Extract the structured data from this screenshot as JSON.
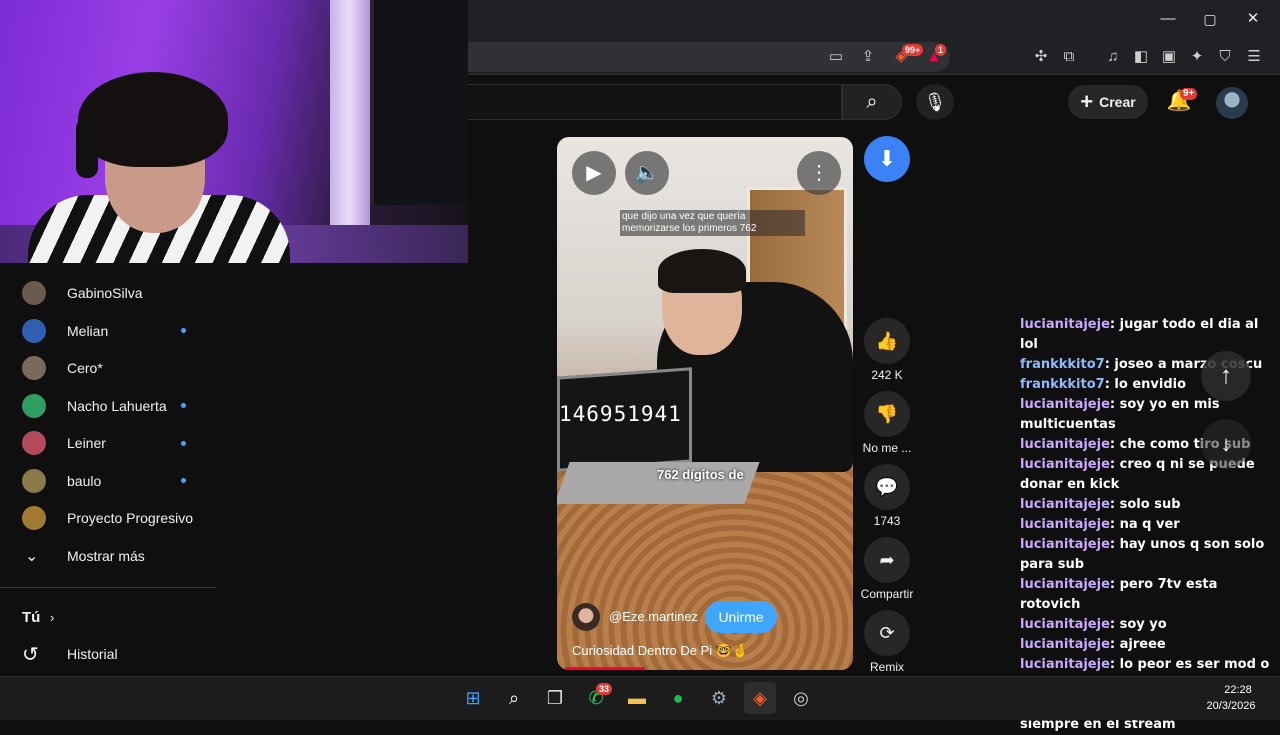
{
  "browser": {
    "minimize_glyph": "—",
    "maximize_glyph": "▢",
    "close_glyph": "✕",
    "brave_badge": "99+",
    "rewards_badge": "1"
  },
  "header": {
    "create_label": "Crear",
    "notifications_badge": "9+"
  },
  "sidebar": {
    "subscriptions": [
      {
        "name": "GabinoSilva",
        "live": false,
        "color": "#6b5a4e"
      },
      {
        "name": "Melian",
        "live": true,
        "color": "#2f5fb3"
      },
      {
        "name": "Cero*",
        "live": false,
        "color": "#7a6a5a"
      },
      {
        "name": "Nacho Lahuerta",
        "live": true,
        "color": "#2e9d62"
      },
      {
        "name": "Leiner",
        "live": true,
        "color": "#b34a5a"
      },
      {
        "name": "baulo",
        "live": true,
        "color": "#8a7a4a"
      },
      {
        "name": "Proyecto Progresivo",
        "live": false,
        "color": "#a07a30"
      }
    ],
    "show_more_label": "Mostrar más",
    "you_label": "Tú",
    "history_label": "Historial"
  },
  "short": {
    "caption_top": "que dijo una vez que quería memorizarse los primeros 762",
    "screen_digits": "146951941",
    "caption_mid": "762 dígitos de",
    "channel": "@Eze.martinez",
    "join_label": "Unirme",
    "title": "Curiosidad Dentro De Pi 🤓🤞"
  },
  "actions": {
    "likes": "242 K",
    "dislike_label": "No me ...",
    "comments": "1743",
    "share_label": "Compartir",
    "remix_label": "Remix"
  },
  "chat": [
    {
      "user": "lucianitajeje",
      "text": "jugar todo el dia al lol",
      "color": "u1"
    },
    {
      "user": "frankkkito7",
      "text": "joseo a marzo coscu",
      "color": "u2"
    },
    {
      "user": "frankkkito7",
      "text": "lo envidio",
      "color": "u2"
    },
    {
      "user": "lucianitajeje",
      "text": "soy yo en mis multicuentas",
      "color": "u1"
    },
    {
      "user": "lucianitajeje",
      "text": "che como tiro sub",
      "color": "u1"
    },
    {
      "user": "lucianitajeje",
      "text": "creo q ni se puede donar en kick",
      "color": "u1"
    },
    {
      "user": "lucianitajeje",
      "text": "solo sub",
      "color": "u1"
    },
    {
      "user": "lucianitajeje",
      "text": "na q ver",
      "color": "u1"
    },
    {
      "user": "lucianitajeje",
      "text": "hay unos q son solo para sub",
      "color": "u1"
    },
    {
      "user": "lucianitajeje",
      "text": "pero 7tv esta rotovich",
      "color": "u1"
    },
    {
      "user": "lucianitajeje",
      "text": "soy yo",
      "color": "u1"
    },
    {
      "user": "lucianitajeje",
      "text": "ajreee",
      "color": "u1"
    },
    {
      "user": "lucianitajeje",
      "text": "lo peor es ser mod o vip tipo q tan al pedo estas",
      "color": "u1"
    },
    {
      "user": "lucianitajeje",
      "text": "o sea esos estan siempre en el stream",
      "color": "u1"
    }
  ],
  "taskbar": {
    "whatsapp_badge": "33",
    "time": "22:28",
    "date": "20/3/2026"
  }
}
